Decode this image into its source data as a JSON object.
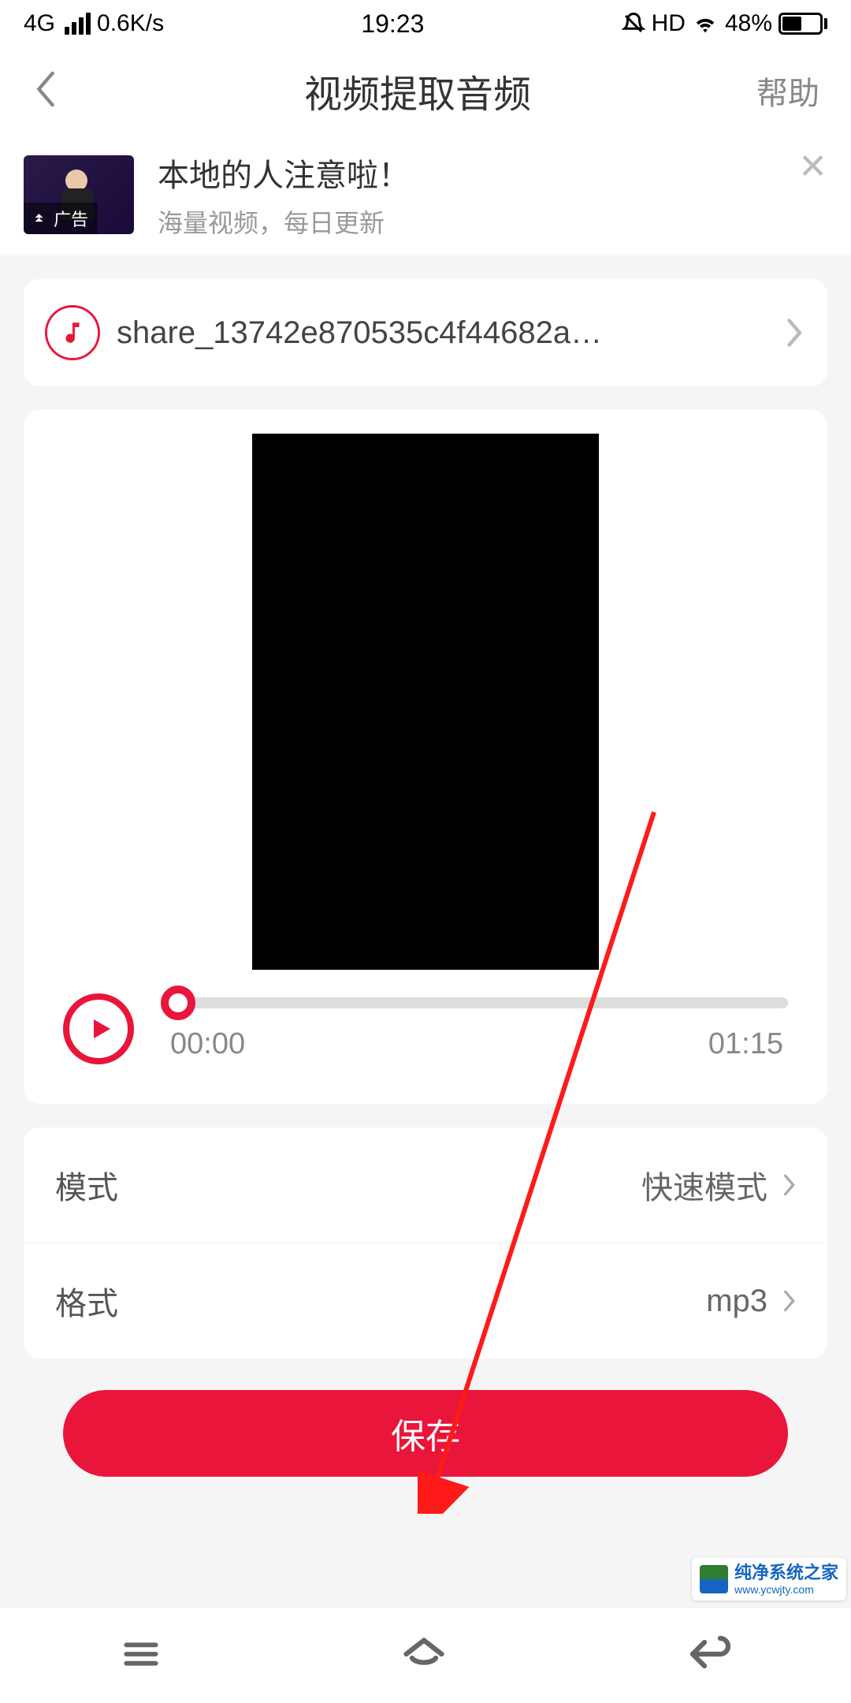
{
  "status": {
    "network": "4G",
    "speed": "0.6K/s",
    "time": "19:23",
    "hd": "HD",
    "battery_pct": "48%"
  },
  "nav": {
    "title": "视频提取音频",
    "help": "帮助"
  },
  "ad": {
    "title": "本地的人注意啦！",
    "subtitle": "海量视频，每日更新",
    "badge": "广告"
  },
  "file": {
    "name": "share_13742e870535c4f44682a…"
  },
  "player": {
    "current": "00:00",
    "total": "01:15"
  },
  "settings": {
    "mode_label": "模式",
    "mode_value": "快速模式",
    "format_label": "格式",
    "format_value": "mp3"
  },
  "actions": {
    "save": "保存"
  },
  "watermark": {
    "title": "纯净系统之家",
    "url": "www.ycwjty.com"
  },
  "colors": {
    "accent": "#e9153a"
  }
}
